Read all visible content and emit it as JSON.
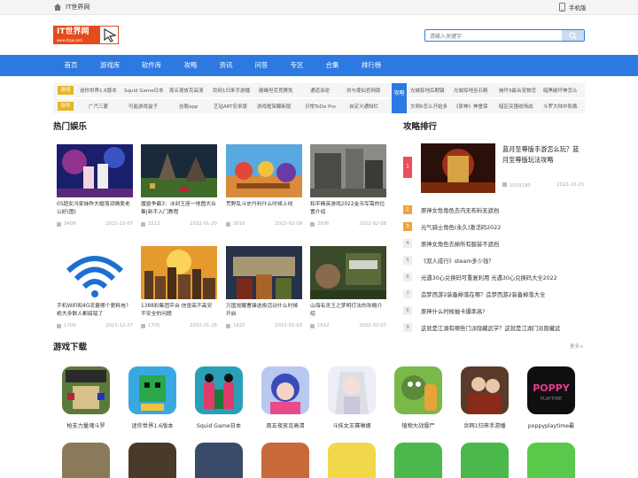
{
  "topbar": {
    "site_name": "IT世界网",
    "mobile": "手机版"
  },
  "header": {
    "logo_text": "IT世界网",
    "logo_sub": "www.itsjw.com",
    "search_placeholder": "请输入关键字"
  },
  "nav": [
    "首页",
    "游戏库",
    "软件库",
    "攻略",
    "资讯",
    "问答",
    "专区",
    "合集",
    "排行榜"
  ],
  "tags": {
    "game_label": "游戏",
    "game": [
      "迷你世界1.6版本",
      "Squid Game日本",
      "周五夜放克高清",
      "剑网1归来手游播",
      "巅峰坦克竞赛免",
      "通道涂逆",
      "刘与使仙官网版"
    ],
    "soft_label": "软件",
    "soft": [
      "广汽三菱",
      "可盐游戏盒子",
      "谷歌app",
      "艺站ART安卓版",
      "游戏框架翻新版",
      "日常ToDo Pro",
      "自定义通知栏"
    ]
  },
  "guide_tags": {
    "label": "攻略",
    "row1": [
      "光城掠地后期镇",
      "光城掠地至石精",
      "崩坏3最合宠物怎",
      "暗黑破坏神怎么"
    ],
    "row2": [
      "文明6怎么开始多",
      "《原神》神童保",
      "暗区突围收场战",
      "斗罗大陆中和裤"
    ]
  },
  "hot": {
    "title": "热门娱乐",
    "cards": [
      {
        "title": "05超女冯家妹昨大婚落泪情美老公好(图)",
        "views": "3409",
        "date": "2021-12-07"
      },
      {
        "title": "魔兽争霸3：冰封王座一地图大合集|新手入门教程",
        "views": "3212",
        "date": "2022-01-20"
      },
      {
        "title": "荒野乱斗史丹利什么时候上线",
        "views": "3016",
        "date": "2022-02-09"
      },
      {
        "title": "和平精英游戏2022金币军需的位置介绍",
        "views": "2936",
        "date": "2022-02-08"
      },
      {
        "title": "手机WiFi和4G流量哪个更耗电？绝大多数人都搞错了",
        "views": "1709",
        "date": "2021-12-27"
      },
      {
        "title": "1388彩集团平台 信誉高不高安不安全的问题",
        "views": "1705",
        "date": "2022-01-26"
      },
      {
        "title": "万国觉醒曹锋选极活动什么时候开启",
        "views": "1622",
        "date": "2022-02-03"
      },
      {
        "title": "山海有灵王之梦明打法的攻略介绍",
        "views": "1612",
        "date": "2022-02-07"
      }
    ]
  },
  "ranking": {
    "title": "攻略排行",
    "featured": {
      "num": "1",
      "title": "蓝月至尊版手游怎么玩？蓝月至尊版玩法攻略",
      "views": "1019180",
      "date": "2022-10-25"
    },
    "items": [
      {
        "n": "2",
        "t": "原神女性角色去内无布料无遮挡"
      },
      {
        "n": "3",
        "t": "元气骑士角色(永久)激活码2022"
      },
      {
        "n": "4",
        "t": "原神女角色去掉所有服装不遮挡"
      },
      {
        "n": "5",
        "t": "《双人成行》steam多少钱？"
      },
      {
        "n": "6",
        "t": "光遇30心兑换码可重复利用 光遇30心兑换码大全2022"
      },
      {
        "n": "7",
        "t": "造梦西游2装备掉落在哪？造梦西游2装备掉落大全"
      },
      {
        "n": "8",
        "t": "原神什么时候抽卡爆率高?"
      },
      {
        "n": "9",
        "t": "这就是江湖有哪些门派隐藏武学？这就是江湖门派隐藏武"
      }
    ]
  },
  "downloads": {
    "title": "游戏下载",
    "more": "更多+",
    "games": [
      "枪支力量魂斗罗",
      "迷你世界1.6版本",
      "Squid Game日本",
      "周五夜放克高清",
      "斗技女王赛琳娜",
      "植物大战僵尸",
      "剑网1归来手游播",
      "poppyplaytime最"
    ]
  },
  "colors": {
    "nav_blue": "#2c79e1",
    "logo_red": "#e54b1d",
    "tag_yellow": "#e8b325",
    "rank_red": "#e8505b",
    "rank_orange": "#f0a23b"
  }
}
